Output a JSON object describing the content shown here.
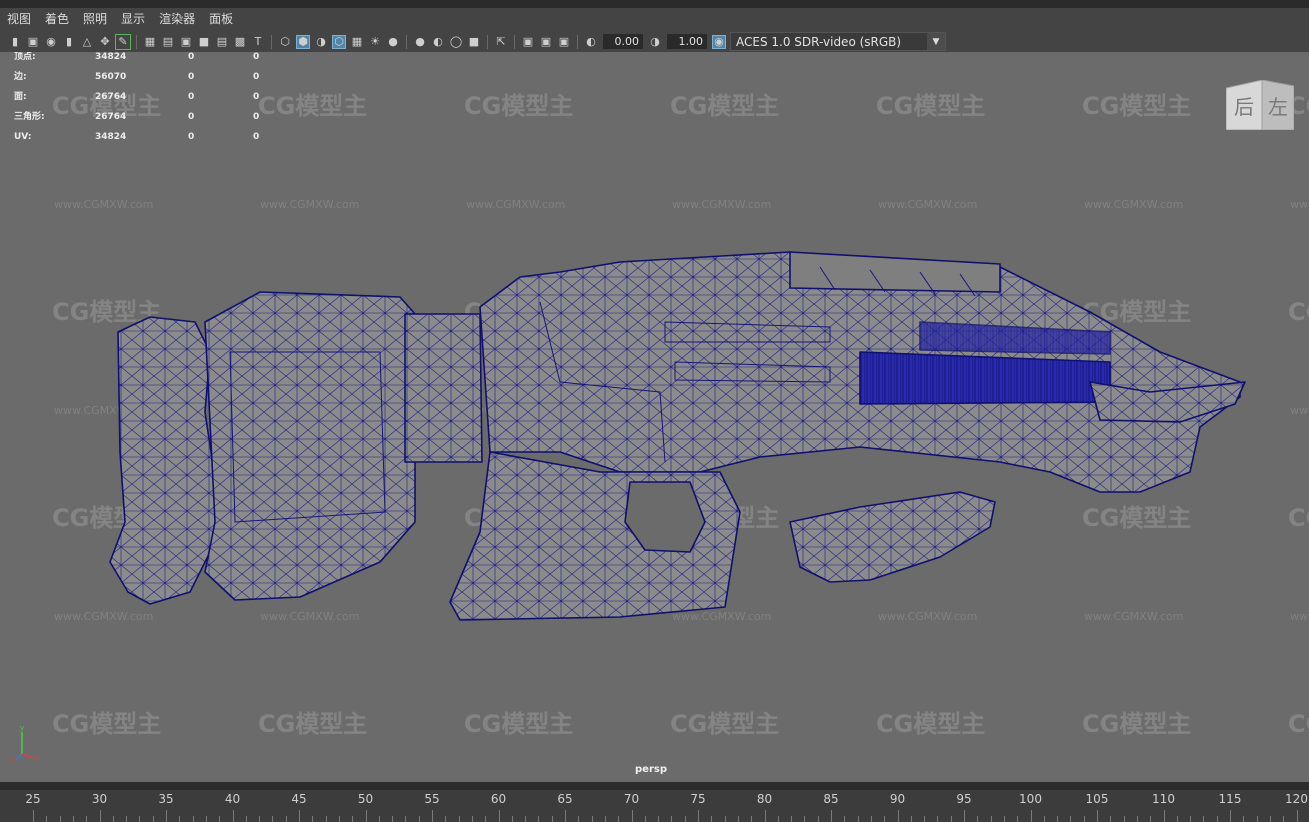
{
  "menubar": {
    "items": [
      "视图",
      "着色",
      "照明",
      "显示",
      "渲染器",
      "面板"
    ]
  },
  "toolbar": {
    "exposure_value": "0.00",
    "gamma_value": "1.00",
    "color_space": "ACES 1.0 SDR-video (sRGB)",
    "icons": [
      "camera-icon",
      "camera-attributes-icon",
      "bookmark-icon",
      "image-plane-icon",
      "grid-icon",
      "film-gate-icon",
      "resolution-gate-icon",
      "safe-action-icon",
      "wireframe-icon",
      "smooth-shade-icon",
      "wireframe-on-shaded-icon",
      "textured-icon",
      "lights-icon",
      "shadows-icon",
      "ambient-occlusion-icon",
      "motion-blur-icon",
      "anti-aliasing-icon",
      "isolate-select-icon",
      "xray-icon",
      "exposure-icon",
      "gamma-icon",
      "color-management-icon"
    ]
  },
  "hud": {
    "rows": [
      {
        "label": "顶点:",
        "v1": "34824",
        "v2": "0",
        "v3": "0"
      },
      {
        "label": "边:",
        "v1": "56070",
        "v2": "0",
        "v3": "0"
      },
      {
        "label": "面:",
        "v1": "26764",
        "v2": "0",
        "v3": "0"
      },
      {
        "label": "三角形:",
        "v1": "26764",
        "v2": "0",
        "v3": "0"
      },
      {
        "label": "UV:",
        "v1": "34824",
        "v2": "0",
        "v3": "0"
      }
    ]
  },
  "viewcube": {
    "face_back": "后",
    "face_left": "左"
  },
  "viewport": {
    "camera_label": "persp",
    "watermark_logo": "CG模型主",
    "watermark_url": "www.CGMXW.com"
  },
  "timeline": {
    "ticks": [
      "25",
      "30",
      "35",
      "40",
      "45",
      "50",
      "55",
      "60",
      "65",
      "70",
      "75",
      "80",
      "85",
      "90",
      "95",
      "100",
      "105",
      "110",
      "115",
      "120"
    ]
  },
  "colors": {
    "viewport_bg": "#6b6b6b",
    "wireframe": "#1a1a7a",
    "mesh_fill": "#8a8a8a",
    "active_button": "#5285a6"
  }
}
